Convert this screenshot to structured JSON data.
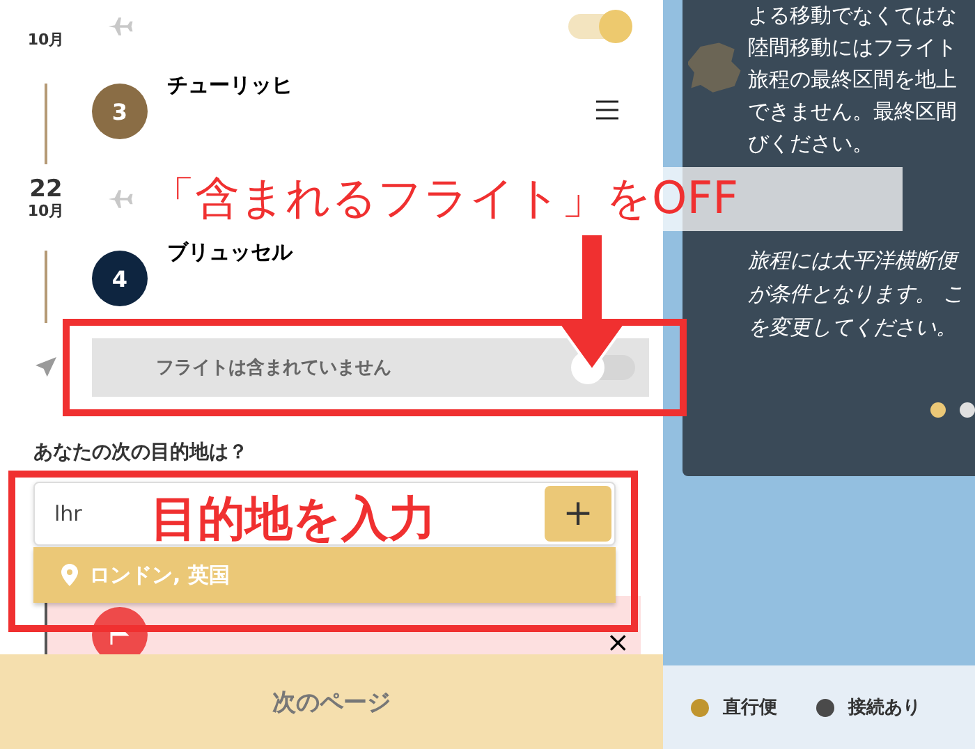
{
  "timeline": [
    {
      "kind": "flight",
      "month": "10月",
      "included": true
    },
    {
      "kind": "stop",
      "number": "3",
      "name": "チューリッヒ",
      "color": "#8a6d45",
      "menu": true
    },
    {
      "kind": "flight",
      "day": "22",
      "month": "10月"
    },
    {
      "kind": "stop",
      "number": "4",
      "name": "ブリュッセル",
      "color": "#0e2540",
      "menu": false
    },
    {
      "kind": "no-flight",
      "label": "フライトは含まれていません",
      "included": false
    }
  ],
  "destination": {
    "question": "あなたの次の目的地は？",
    "value": "lhr",
    "add_button": "+",
    "suggestion": "ロンドン, 英国"
  },
  "final_stop": {
    "remove": "×"
  },
  "next_button": "次のページ",
  "info_panel": {
    "paragraph_lines": [
      "よる移動でなくてはな",
      "陸間移動にはフライト",
      "旅程の最終区間を地上",
      "できません。最終区間",
      "びください。"
    ],
    "rules_lines": [
      "旅程には太平洋横断便",
      "が条件となります。 こ",
      "を変更してください。"
    ],
    "dots": [
      {
        "selected": true
      },
      {
        "selected": false
      }
    ]
  },
  "legend": [
    {
      "label": "直行便",
      "color": "#c0952f"
    },
    {
      "label": "接続あり",
      "color": "#4a4a4a"
    }
  ],
  "annotations": {
    "callout": "「含まれるフライト」をOFF",
    "input_note": "目的地を入力"
  }
}
